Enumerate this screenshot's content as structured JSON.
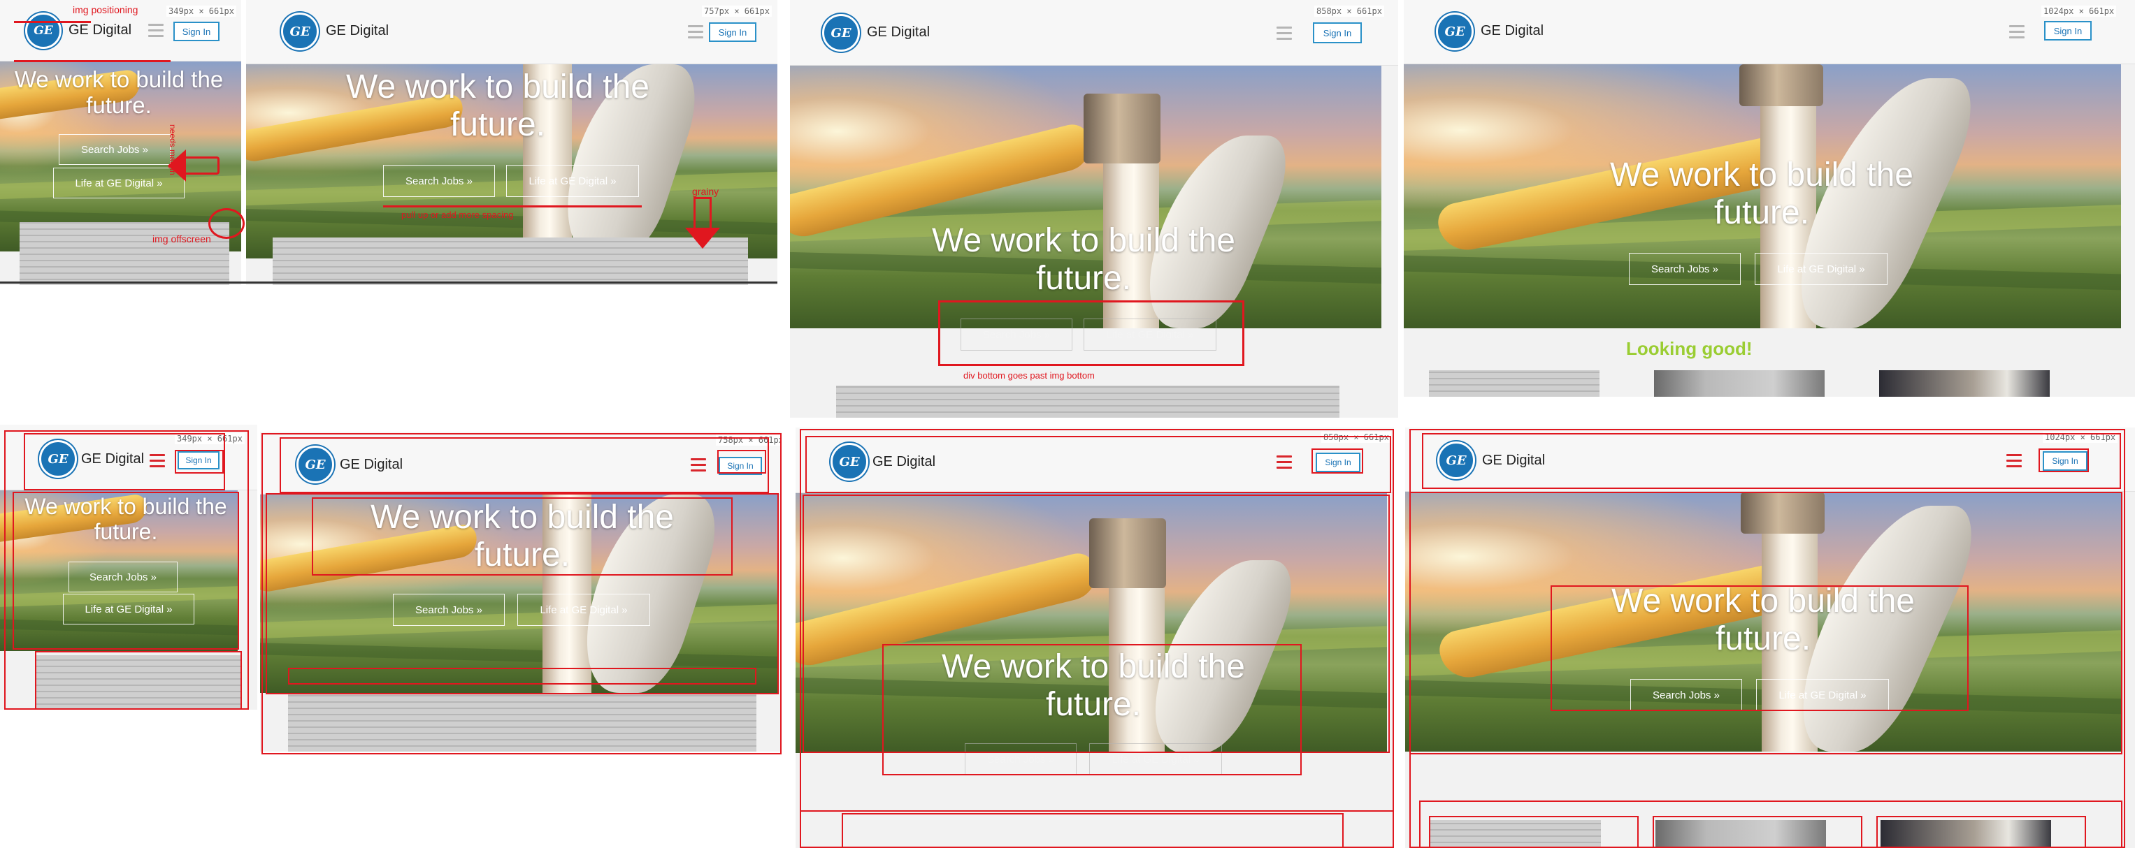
{
  "brand": {
    "name": "GE Digital",
    "logo_text": "GE",
    "signin_label": "Sign In",
    "menu_icon": "hamburger-icon"
  },
  "hero": {
    "headline": "We work to build the future.",
    "search_button": "Search Jobs »",
    "life_button": "Life at GE Digital »"
  },
  "viewports": [
    {
      "dims": "349px × 661px",
      "marked": false
    },
    {
      "dims": "757px × 661px",
      "marked": false
    },
    {
      "dims": "858px × 661px",
      "marked": false
    },
    {
      "dims": "1024px × 661px",
      "marked": false
    },
    {
      "dims": "349px × 661px",
      "marked": true
    },
    {
      "dims": "758px × 661px",
      "marked": true
    },
    {
      "dims": "858px × 661px",
      "marked": true
    },
    {
      "dims": "1024px × 661px",
      "marked": true
    }
  ],
  "annotations": {
    "img_positioning": "img positioning",
    "img_offscreen": "img offscreen",
    "needs_margin": "needs margin",
    "pull_up": "pull up or add more spacing",
    "grainy": "grainy",
    "div_bottom": "div bottom goes past img bottom",
    "looking_good": "Looking good!"
  },
  "colors": {
    "accent_blue": "#1a73b5",
    "annotation_red": "#e0171f",
    "ok_green": "#9acd32",
    "menu_gray": "#b5b5b5",
    "menu_red": "#d9262c"
  }
}
